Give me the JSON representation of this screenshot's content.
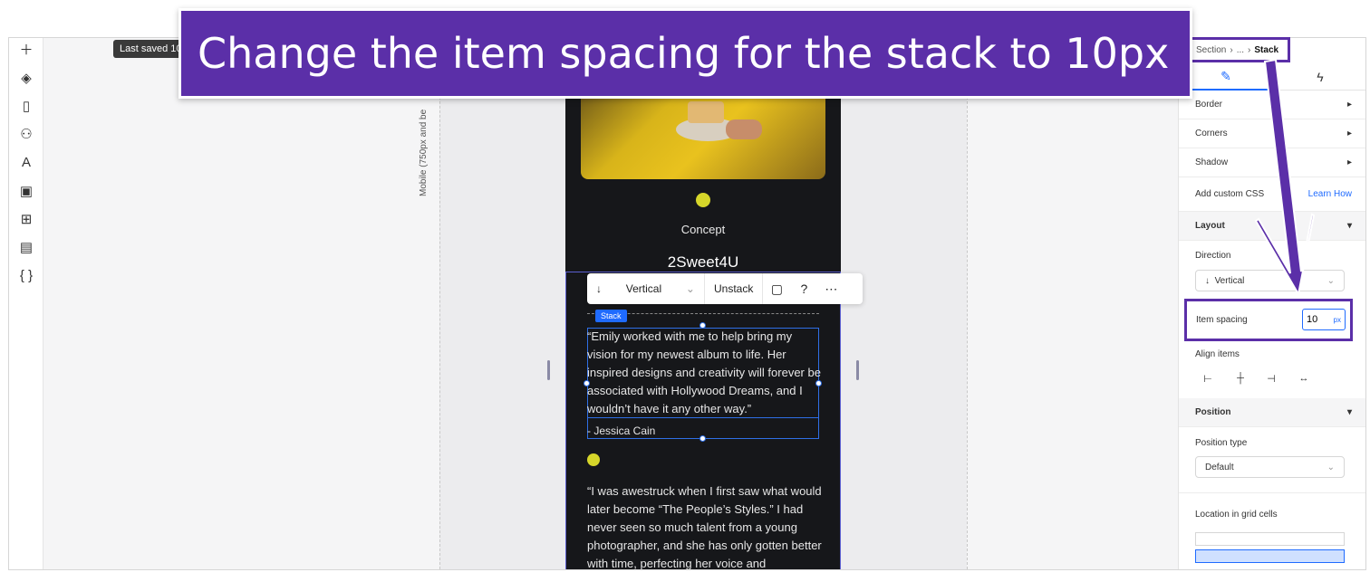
{
  "banner": {
    "text": "Change the item spacing for the stack to 10px"
  },
  "left_toolbar": {
    "saved_tooltip": "Last saved 10",
    "icons": [
      "add-icon",
      "layers-icon",
      "pages-icon",
      "apps-icon",
      "text-theme-icon",
      "media-icon",
      "grid-apps-icon",
      "table-icon",
      "code-braces-icon"
    ]
  },
  "canvas": {
    "viewport_label": "Mobile (750px and be",
    "concept": "Concept",
    "brand": "2Sweet4U",
    "stack_badge": "Stack",
    "quote1": "“Emily worked with me to help bring my vision for my newest album to life. Her inspired designs and creativity will forever be associated with Hollywood Dreams, and I wouldn’t have it any other way.”",
    "author1": "- Jessica Cain",
    "quote2": "“I was awestruck when I first saw what would later become “The People’s Styles.” I had never seen so much talent from a young photographer, and she has only gotten better with time, perfecting her voice and"
  },
  "float_toolbar": {
    "direction": "Vertical",
    "unstack": "Unstack"
  },
  "inspector": {
    "breadcrumb": {
      "section": "Section",
      "ellipsis": "...",
      "current": "Stack"
    },
    "rows": {
      "border": "Border",
      "corners": "Corners",
      "shadow": "Shadow",
      "custom_css": "Add custom CSS",
      "learn_how": "Learn How"
    },
    "layout": {
      "header": "Layout",
      "direction_label": "Direction",
      "direction_value": "Vertical",
      "item_spacing_label": "Item spacing",
      "item_spacing_value": "10",
      "item_spacing_unit": "px",
      "align_label": "Align items"
    },
    "position": {
      "header": "Position",
      "type_label": "Position type",
      "type_value": "Default",
      "grid_label": "Location in grid cells"
    }
  },
  "colors": {
    "accent": "#1f6bff",
    "banner": "#5b2fa8",
    "yellow_dot": "#d6d62a"
  }
}
